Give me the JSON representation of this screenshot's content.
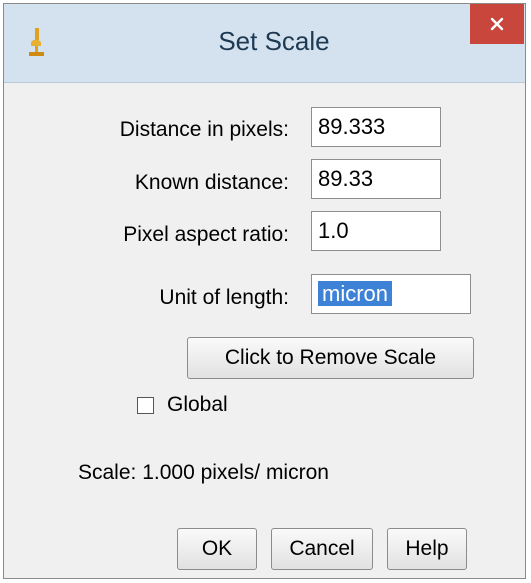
{
  "window": {
    "title": "Set Scale"
  },
  "fields": {
    "distance_in_pixels": {
      "label": "Distance in pixels:",
      "value": "89.333"
    },
    "known_distance": {
      "label": "Known distance:",
      "value": "89.33"
    },
    "pixel_aspect_ratio": {
      "label": "Pixel aspect ratio:",
      "value": "1.0"
    },
    "unit_of_length": {
      "label": "Unit of length:",
      "value": "micron"
    }
  },
  "remove_scale_button": "Click to Remove Scale",
  "global_checkbox": {
    "label": "Global",
    "checked": false
  },
  "scale_info": "Scale: 1.000 pixels/ micron",
  "buttons": {
    "ok": "OK",
    "cancel": "Cancel",
    "help": "Help"
  },
  "icons": {
    "app": "microscope-icon",
    "close": "close-icon"
  },
  "colors": {
    "close_button": "#c9463d",
    "selection": "#3e82d8",
    "titlebar": "#d4e2f0"
  }
}
